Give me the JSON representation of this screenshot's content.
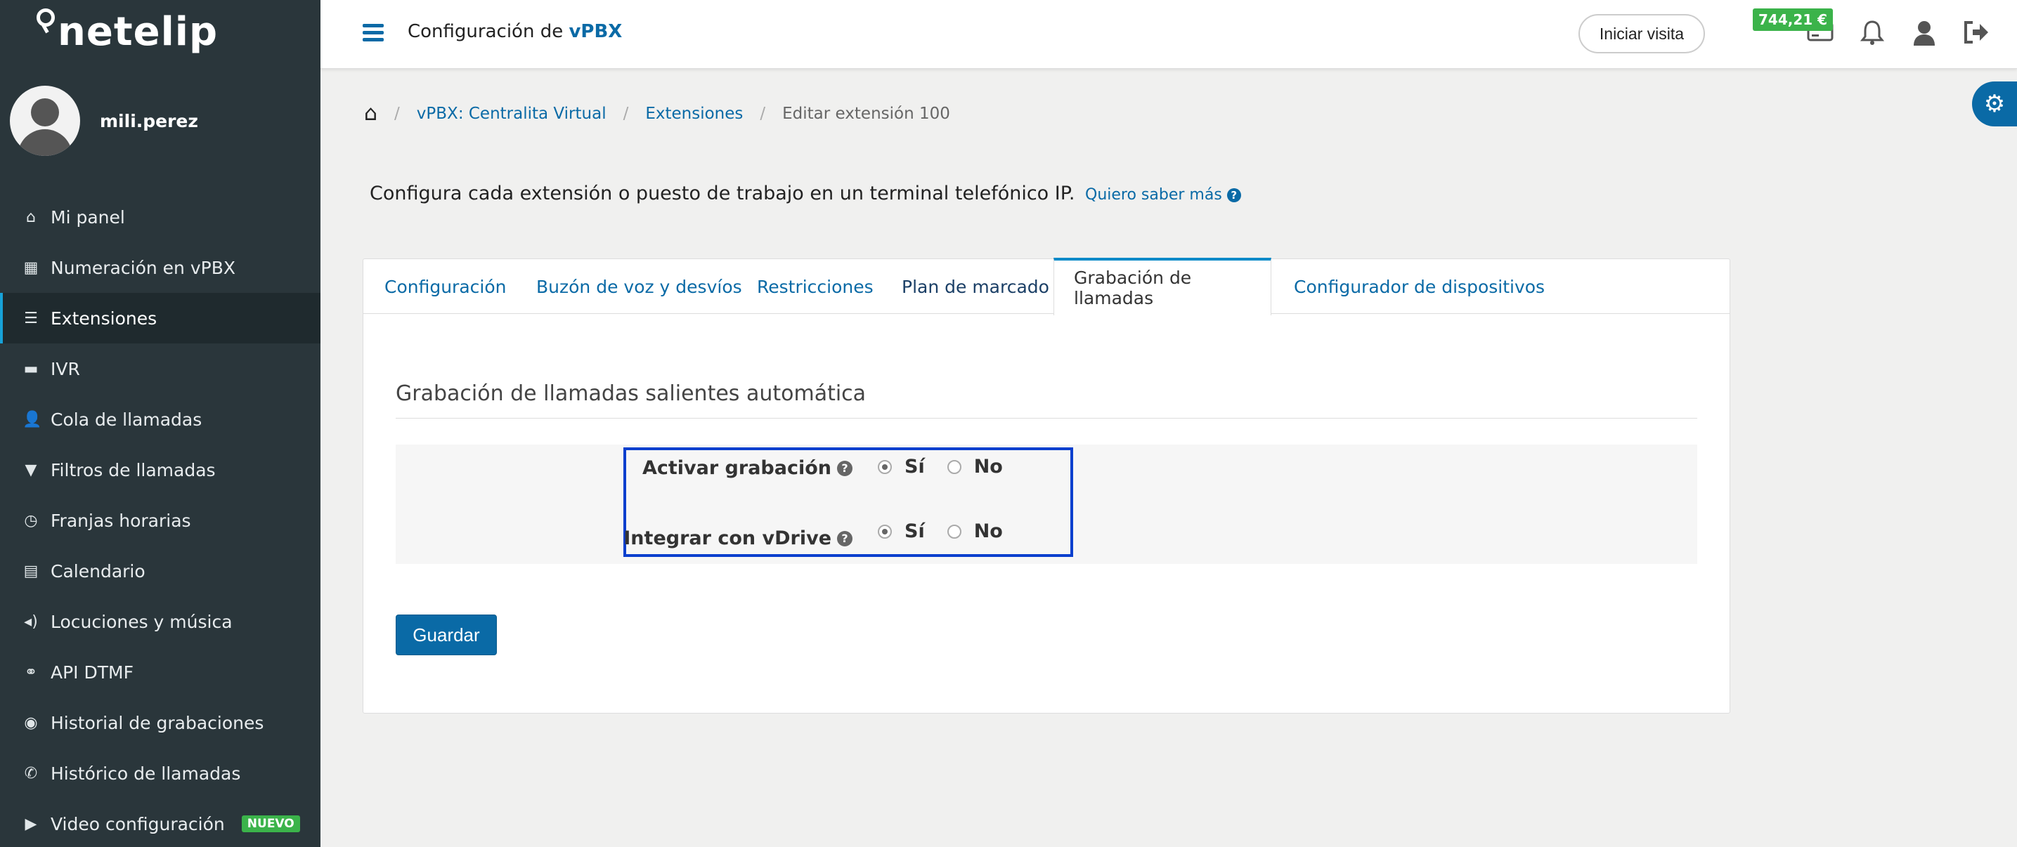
{
  "brand": {
    "logo_text": "netelip"
  },
  "user": {
    "username": "mili.perez"
  },
  "sidebar": {
    "items": [
      {
        "label": "Mi panel",
        "icon": "home-icon",
        "glyph": "⌂"
      },
      {
        "label": "Numeración en vPBX",
        "icon": "grid-icon",
        "glyph": "▦"
      },
      {
        "label": "Extensiones",
        "icon": "list-icon",
        "glyph": "☰"
      },
      {
        "label": "IVR",
        "icon": "comment-icon",
        "glyph": "▬"
      },
      {
        "label": "Cola de llamadas",
        "icon": "person-icon",
        "glyph": "👤"
      },
      {
        "label": "Filtros de llamadas",
        "icon": "filter-icon",
        "glyph": "▼"
      },
      {
        "label": "Franjas horarias",
        "icon": "clock-icon",
        "glyph": "◷"
      },
      {
        "label": "Calendario",
        "icon": "calendar-icon",
        "glyph": "▤"
      },
      {
        "label": "Locuciones y música",
        "icon": "speaker-icon",
        "glyph": "◂)"
      },
      {
        "label": "API DTMF",
        "icon": "link-icon",
        "glyph": "⚭"
      },
      {
        "label": "Historial de grabaciones",
        "icon": "record-icon",
        "glyph": "◉"
      },
      {
        "label": "Histórico de llamadas",
        "icon": "phone-icon",
        "glyph": "✆"
      },
      {
        "label": "Video configuración",
        "icon": "video-icon",
        "glyph": "▶",
        "badge": "NUEVO"
      }
    ],
    "active_index": 2
  },
  "header": {
    "title_prefix": "Configuración de ",
    "title_brand": "vPBX",
    "visit_button": "Iniciar visita",
    "balance": "744,21 €"
  },
  "breadcrumb": {
    "items": [
      "vPBX: Centralita Virtual",
      "Extensiones"
    ],
    "current": "Editar extensión 100"
  },
  "intro": {
    "text": "Configura cada extensión o puesto de trabajo en un terminal telefónico IP.",
    "more_link": "Quiero saber más"
  },
  "tabs": [
    "Configuración",
    "Buzón de voz y desvíos",
    "Restricciones",
    "Plan de marcado",
    "Grabación de llamadas",
    "Configurador de dispositivos"
  ],
  "active_tab": 4,
  "section": {
    "title": "Grabación de llamadas salientes automática",
    "fields": [
      {
        "label": "Activar grabación",
        "yes": "Sí",
        "no": "No",
        "value": "Sí"
      },
      {
        "label": "Integrar con vDrive",
        "yes": "Sí",
        "no": "No",
        "value": "Sí"
      }
    ]
  },
  "actions": {
    "save": "Guardar"
  },
  "colors": {
    "sidebar": "#2a363b",
    "primary": "#0a6aa6",
    "success": "#3bb34a",
    "highlight": "#0a3fce"
  }
}
